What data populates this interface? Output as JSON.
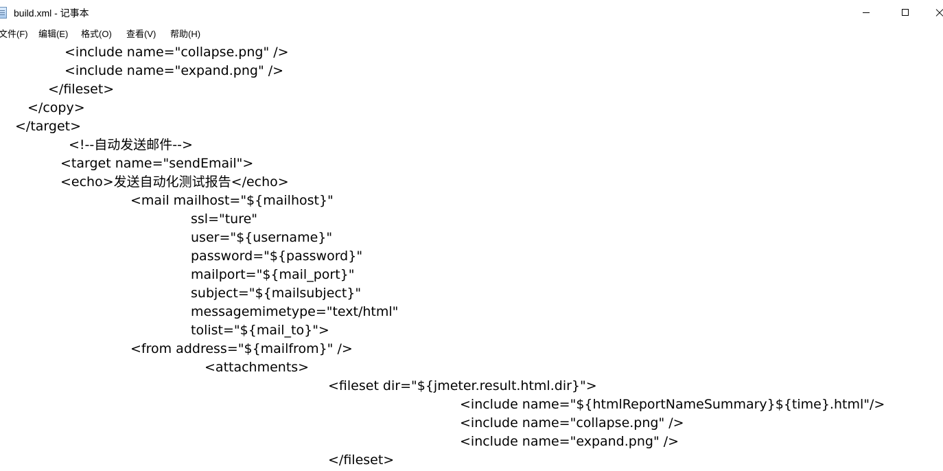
{
  "window": {
    "title": "build.xml - 记事本",
    "app_icon": "notepad-icon",
    "controls": {
      "minimize_icon": "minimize-icon",
      "maximize_icon": "maximize-icon",
      "close_icon": "close-icon"
    }
  },
  "menu": {
    "file": "文件(F)",
    "edit": "编辑(E)",
    "format": "格式(O)",
    "view": "查看(V)",
    "help": "帮助(H)"
  },
  "editor": {
    "lines": [
      "<include name=\"collapse.png\" />",
      "<include name=\"expand.png\" />",
      "</fileset>",
      "</copy>",
      "</target>",
      "<!--自动发送邮件-->",
      "<target name=\"sendEmail\">",
      "<echo>发送自动化测试报告</echo>",
      "<mail mailhost=\"${mailhost}\"",
      "ssl=\"ture\"",
      "user=\"${username}\"",
      "password=\"${password}\"",
      "mailport=\"${mail_port}\"",
      "subject=\"${mailsubject}\"",
      "messagemimetype=\"text/html\"",
      "tolist=\"${mail_to}\">",
      "<from address=\"${mailfrom}\" />",
      "<attachments>",
      "<fileset dir=\"${jmeter.result.html.dir}\">",
      "<include name=\"${htmlReportNameSummary}${time}.html\"/>",
      "<include name=\"collapse.png\" />",
      "<include name=\"expand.png\" />",
      "</fileset>"
    ]
  }
}
